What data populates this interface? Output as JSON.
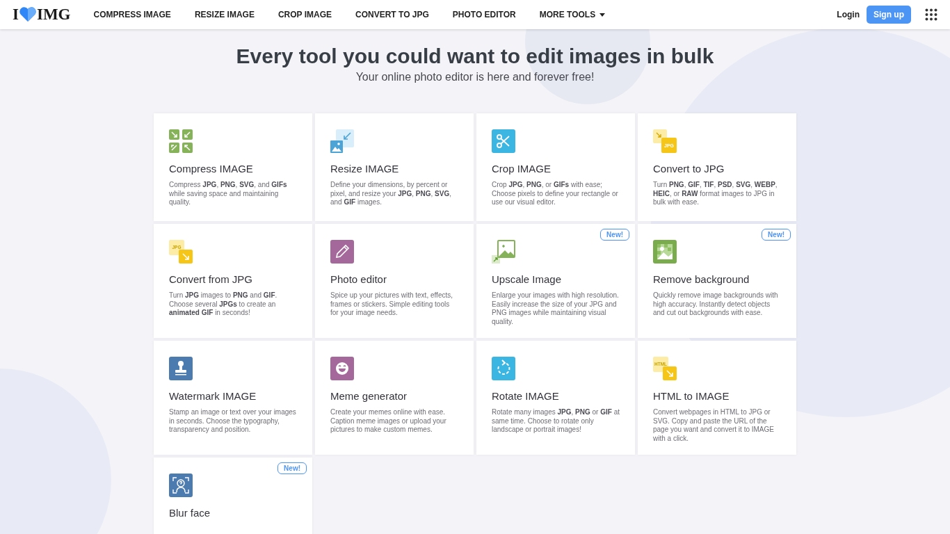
{
  "header": {
    "logo": {
      "left": "I",
      "right": "IMG"
    },
    "nav": [
      {
        "label": "COMPRESS IMAGE",
        "dropdown": false
      },
      {
        "label": "RESIZE IMAGE",
        "dropdown": false
      },
      {
        "label": "CROP IMAGE",
        "dropdown": false
      },
      {
        "label": "CONVERT TO JPG",
        "dropdown": false
      },
      {
        "label": "PHOTO EDITOR",
        "dropdown": false
      },
      {
        "label": "MORE TOOLS",
        "dropdown": true
      }
    ],
    "login": "Login",
    "signup": "Sign up"
  },
  "hero": {
    "title": "Every tool you could want to edit images in bulk",
    "subtitle": "Your online photo editor is here and forever free!"
  },
  "tools": [
    {
      "kind": "compress",
      "color": "#86b35a",
      "title": "Compress IMAGE",
      "description": "Compress **JPG**, **PNG**, **SVG**, and **GIFs** while saving space and maintaining quality.",
      "new_badge": false
    },
    {
      "kind": "resize",
      "color": "#4ba3d6",
      "title": "Resize IMAGE",
      "description": "Define your dimensions, by percent or pixel, and resize your **JPG**, **PNG**, **SVG**, and **GIF** images.",
      "new_badge": false
    },
    {
      "kind": "crop",
      "color": "#3bb5e2",
      "title": "Crop IMAGE",
      "description": "Crop **JPG**, **PNG**, or **GIFs** with ease; Choose pixels to define your rectangle or use our visual editor.",
      "new_badge": false
    },
    {
      "kind": "convert-to",
      "color": "#f5c518",
      "icon_text": "JPG",
      "title": "Convert to JPG",
      "description": "Turn **PNG**, **GIF**, **TIF**, **PSD**, **SVG**, **WEBP**, **HEIC**, or **RAW** format images to JPG in bulk with ease.",
      "new_badge": false
    },
    {
      "kind": "convert-from",
      "color": "#f5c518",
      "icon_text": "JPG",
      "title": "Convert from JPG",
      "description": "Turn **JPG** images to **PNG** and **GIF**. Choose several **JPGs** to create an **animated GIF** in seconds!",
      "new_badge": false
    },
    {
      "kind": "pencil",
      "color": "#a4689a",
      "title": "Photo editor",
      "description": "Spice up your pictures with text, effects, frames or stickers. Simple editing tools for your image needs.",
      "new_badge": false
    },
    {
      "kind": "upscale",
      "color": "#86b35a",
      "title": "Upscale Image",
      "description": "Enlarge your images with high resolution. Easily increase the size of your JPG and PNG images while maintaining visual quality.",
      "new_badge": true,
      "badge": "New!"
    },
    {
      "kind": "remove-bg",
      "color": "#7aab4c",
      "title": "Remove background",
      "description": "Quickly remove image backgrounds with high accuracy. Instantly detect objects and cut out backgrounds with ease.",
      "new_badge": true,
      "badge": "New!"
    },
    {
      "kind": "stamp",
      "color": "#4c7bb0",
      "title": "Watermark IMAGE",
      "description": "Stamp an image or text over your images in seconds. Choose the typography, transparency and position.",
      "new_badge": false
    },
    {
      "kind": "smile",
      "color": "#a4689a",
      "title": "Meme generator",
      "description": "Create your memes online with ease. Caption meme images or upload your pictures to make custom memes.",
      "new_badge": false
    },
    {
      "kind": "rotate",
      "color": "#3bb5e2",
      "title": "Rotate IMAGE",
      "description": "Rotate many images **JPG**, **PNG** or **GIF** at same time. Choose to rotate only landscape or portrait images!",
      "new_badge": false
    },
    {
      "kind": "convert-from",
      "color": "#f5c518",
      "icon_text": "HTML",
      "title": "HTML to IMAGE",
      "description": "Convert webpages in HTML to JPG or SVG. Copy and paste the URL of the page you want and convert it to IMAGE with a click.",
      "new_badge": false
    },
    {
      "kind": "face",
      "color": "#4c7bb0",
      "title": "Blur face",
      "new_badge": true,
      "badge": "New!"
    }
  ]
}
